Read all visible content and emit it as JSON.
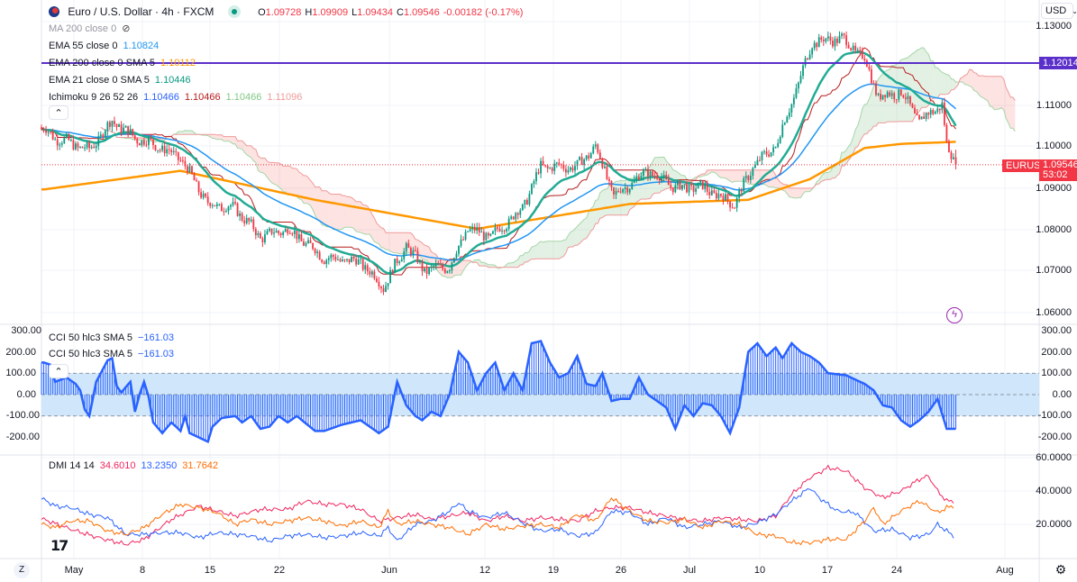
{
  "header": {
    "symbol": "Euro / U.S. Dollar · 4h · FXCM",
    "open_label": "O",
    "open": "1.09728",
    "high_label": "H",
    "high": "1.09909",
    "low_label": "L",
    "low": "1.09434",
    "close_label": "C",
    "close": "1.09546",
    "change": "-0.00182 (-0.17%)",
    "market_status_icon": "market-open-dot"
  },
  "indicators": {
    "ma200": {
      "label": "MA 200 close 0",
      "icon": "eye-hidden-icon"
    },
    "ema55": {
      "label": "EMA 55 close 0",
      "value": "1.10824",
      "color": "#2196f3"
    },
    "ema200": {
      "label": "EMA 200 close 0 SMA 5",
      "value": "1.10112",
      "color": "#ff9800"
    },
    "ema21": {
      "label": "EMA 21 close 0 SMA 5",
      "value": "1.10446",
      "color": "#089981"
    },
    "ichimoku": {
      "label": "Ichimoku 9 26 52 26",
      "v1": "1.10466",
      "v2": "1.10466",
      "v3": "1.10466",
      "v4": "1.11096"
    },
    "cci1": {
      "label": "CCI 50 hlc3 SMA 5",
      "value": "−161.03"
    },
    "cci2": {
      "label": "CCI 50 hlc3 SMA 5",
      "value": "−161.03"
    },
    "dmi": {
      "label": "DMI 14 14",
      "adx": "34.6010",
      "plus": "13.2350",
      "minus": "31.7642"
    }
  },
  "price_axis": {
    "currency": "USD",
    "ticks": [
      "1.13000",
      "1.11000",
      "1.10000",
      "1.09000",
      "1.08000",
      "1.07000",
      "1.06000"
    ],
    "hline_value": "1.12014",
    "symbol_tag": "EURUSD",
    "last_price": "1.09546",
    "countdown": "53:02"
  },
  "cci_axis": {
    "ticks": [
      "300.00",
      "200.00",
      "100.00",
      "0.00",
      "-100.00",
      "-200.00"
    ]
  },
  "dmi_axis": {
    "ticks": [
      "60.0000",
      "40.0000",
      "20.0000"
    ]
  },
  "time_axis": {
    "labels": [
      "May",
      "8",
      "15",
      "22",
      "Jun",
      "12",
      "19",
      "26",
      "Jul",
      "10",
      "17",
      "24",
      "Aug"
    ],
    "zoom_button": "Z"
  },
  "colors": {
    "up": "#089981",
    "down": "#f23645",
    "hline": "#5b2fc9",
    "cci": "#2962ff",
    "adx": "#f0265f",
    "plus_di": "#2962ff",
    "minus_di": "#ff6d00"
  },
  "chart_data": {
    "type": "candlestick",
    "bars": 402,
    "price_path": [
      [
        1,
        1.104
      ],
      [
        6,
        1.102
      ],
      [
        21,
        1.099
      ],
      [
        31,
        1.106
      ],
      [
        41,
        1.102
      ],
      [
        51,
        1.1
      ],
      [
        61,
        1.097
      ],
      [
        73,
        1.086
      ],
      [
        85,
        1.085
      ],
      [
        96,
        1.078
      ],
      [
        108,
        1.08
      ],
      [
        124,
        1.073
      ],
      [
        140,
        1.072
      ],
      [
        150,
        1.066
      ],
      [
        160,
        1.076
      ],
      [
        168,
        1.07
      ],
      [
        179,
        1.071
      ],
      [
        187,
        1.08
      ],
      [
        197,
        1.078
      ],
      [
        211,
        1.085
      ],
      [
        219,
        1.095
      ],
      [
        235,
        1.095
      ],
      [
        243,
        1.1
      ],
      [
        251,
        1.088
      ],
      [
        266,
        1.094
      ],
      [
        278,
        1.09
      ],
      [
        290,
        1.09
      ],
      [
        304,
        1.086
      ],
      [
        312,
        1.095
      ],
      [
        322,
        1.1
      ],
      [
        332,
        1.115
      ],
      [
        338,
        1.125
      ],
      [
        351,
        1.126
      ],
      [
        361,
        1.121
      ],
      [
        367,
        1.112
      ],
      [
        377,
        1.113
      ],
      [
        385,
        1.106
      ],
      [
        395,
        1.11
      ],
      [
        397,
        1.1
      ],
      [
        401,
        1.0955
      ]
    ],
    "ema200_path": [
      [
        1,
        1.0895
      ],
      [
        61,
        1.094
      ],
      [
        120,
        1.087
      ],
      [
        191,
        1.08
      ],
      [
        258,
        1.086
      ],
      [
        310,
        1.087
      ],
      [
        337,
        1.092
      ],
      [
        361,
        1.0995
      ],
      [
        377,
        1.1005
      ],
      [
        401,
        1.101
      ]
    ],
    "cci_path": [
      [
        1,
        150
      ],
      [
        4,
        140
      ],
      [
        6,
        60
      ],
      [
        11,
        80
      ],
      [
        15,
        50
      ],
      [
        17,
        20
      ],
      [
        19,
        -70
      ],
      [
        21,
        -100
      ],
      [
        24,
        60
      ],
      [
        29,
        160
      ],
      [
        31,
        170
      ],
      [
        33,
        40
      ],
      [
        35,
        10
      ],
      [
        39,
        60
      ],
      [
        41,
        -80
      ],
      [
        43,
        0
      ],
      [
        45,
        60
      ],
      [
        47,
        -10
      ],
      [
        49,
        -130
      ],
      [
        53,
        -180
      ],
      [
        57,
        -130
      ],
      [
        61,
        -170
      ],
      [
        63,
        -100
      ],
      [
        65,
        -180
      ],
      [
        69,
        -200
      ],
      [
        73,
        -220
      ],
      [
        75,
        -150
      ],
      [
        79,
        -110
      ],
      [
        85,
        -100
      ],
      [
        88,
        -130
      ],
      [
        92,
        -100
      ],
      [
        96,
        -160
      ],
      [
        100,
        -150
      ],
      [
        104,
        -100
      ],
      [
        108,
        -130
      ],
      [
        112,
        -100
      ],
      [
        120,
        -170
      ],
      [
        124,
        -170
      ],
      [
        132,
        -140
      ],
      [
        140,
        -120
      ],
      [
        148,
        -180
      ],
      [
        152,
        -150
      ],
      [
        156,
        60
      ],
      [
        160,
        -50
      ],
      [
        164,
        -100
      ],
      [
        167,
        -120
      ],
      [
        171,
        -80
      ],
      [
        175,
        -100
      ],
      [
        179,
        0
      ],
      [
        183,
        200
      ],
      [
        187,
        150
      ],
      [
        191,
        20
      ],
      [
        195,
        100
      ],
      [
        199,
        150
      ],
      [
        203,
        20
      ],
      [
        207,
        100
      ],
      [
        211,
        20
      ],
      [
        215,
        240
      ],
      [
        219,
        250
      ],
      [
        223,
        150
      ],
      [
        227,
        80
      ],
      [
        231,
        100
      ],
      [
        235,
        180
      ],
      [
        239,
        50
      ],
      [
        243,
        40
      ],
      [
        246,
        100
      ],
      [
        250,
        -30
      ],
      [
        254,
        -20
      ],
      [
        258,
        -20
      ],
      [
        262,
        80
      ],
      [
        266,
        0
      ],
      [
        270,
        -30
      ],
      [
        274,
        -60
      ],
      [
        278,
        -160
      ],
      [
        282,
        -50
      ],
      [
        286,
        -100
      ],
      [
        290,
        -40
      ],
      [
        294,
        -50
      ],
      [
        298,
        -100
      ],
      [
        302,
        -180
      ],
      [
        306,
        -60
      ],
      [
        310,
        200
      ],
      [
        314,
        240
      ],
      [
        318,
        180
      ],
      [
        322,
        220
      ],
      [
        325,
        170
      ],
      [
        329,
        240
      ],
      [
        333,
        200
      ],
      [
        337,
        180
      ],
      [
        341,
        150
      ],
      [
        345,
        100
      ],
      [
        353,
        90
      ],
      [
        361,
        50
      ],
      [
        365,
        20
      ],
      [
        369,
        -50
      ],
      [
        373,
        -60
      ],
      [
        377,
        -120
      ],
      [
        381,
        -150
      ],
      [
        385,
        -120
      ],
      [
        389,
        -80
      ],
      [
        393,
        -20
      ],
      [
        397,
        -160
      ],
      [
        401,
        -160
      ]
    ],
    "cci_bands": [
      100,
      -100
    ],
    "adx_path": [
      [
        1,
        23
      ],
      [
        13,
        17
      ],
      [
        25,
        12
      ],
      [
        37,
        8
      ],
      [
        45,
        11
      ],
      [
        57,
        23
      ],
      [
        69,
        31
      ],
      [
        85,
        25
      ],
      [
        96,
        29
      ],
      [
        108,
        29
      ],
      [
        116,
        34
      ],
      [
        124,
        32
      ],
      [
        132,
        32
      ],
      [
        140,
        29
      ],
      [
        148,
        22
      ],
      [
        156,
        24
      ],
      [
        164,
        26
      ],
      [
        171,
        23
      ],
      [
        179,
        25
      ],
      [
        187,
        27
      ],
      [
        195,
        22
      ],
      [
        203,
        25
      ],
      [
        211,
        22
      ],
      [
        219,
        24
      ],
      [
        227,
        23
      ],
      [
        235,
        22
      ],
      [
        243,
        28
      ],
      [
        250,
        30
      ],
      [
        258,
        30
      ],
      [
        266,
        27
      ],
      [
        274,
        25
      ],
      [
        282,
        23
      ],
      [
        290,
        22
      ],
      [
        298,
        24
      ],
      [
        306,
        23
      ],
      [
        314,
        22
      ],
      [
        322,
        25
      ],
      [
        329,
        38
      ],
      [
        337,
        48
      ],
      [
        345,
        54
      ],
      [
        353,
        52
      ],
      [
        361,
        42
      ],
      [
        369,
        36
      ],
      [
        377,
        40
      ],
      [
        385,
        47
      ],
      [
        389,
        49
      ],
      [
        393,
        40
      ],
      [
        397,
        34
      ],
      [
        400,
        34
      ]
    ],
    "plus_di_path": [
      [
        1,
        35
      ],
      [
        6,
        31
      ],
      [
        13,
        30
      ],
      [
        21,
        26
      ],
      [
        29,
        24
      ],
      [
        37,
        14
      ],
      [
        45,
        14
      ],
      [
        53,
        15
      ],
      [
        61,
        15
      ],
      [
        69,
        12
      ],
      [
        77,
        15
      ],
      [
        85,
        14
      ],
      [
        92,
        13
      ],
      [
        100,
        10
      ],
      [
        108,
        13
      ],
      [
        116,
        14
      ],
      [
        124,
        12
      ],
      [
        132,
        13
      ],
      [
        140,
        15
      ],
      [
        148,
        13
      ],
      [
        152,
        18
      ],
      [
        156,
        10
      ],
      [
        164,
        20
      ],
      [
        171,
        22
      ],
      [
        179,
        28
      ],
      [
        183,
        33
      ],
      [
        187,
        28
      ],
      [
        195,
        24
      ],
      [
        203,
        27
      ],
      [
        211,
        21
      ],
      [
        219,
        16
      ],
      [
        227,
        17
      ],
      [
        235,
        13
      ],
      [
        243,
        15
      ],
      [
        250,
        28
      ],
      [
        258,
        27
      ],
      [
        266,
        20
      ],
      [
        274,
        24
      ],
      [
        282,
        18
      ],
      [
        290,
        20
      ],
      [
        298,
        22
      ],
      [
        306,
        18
      ],
      [
        314,
        21
      ],
      [
        322,
        26
      ],
      [
        329,
        34
      ],
      [
        337,
        42
      ],
      [
        341,
        36
      ],
      [
        349,
        28
      ],
      [
        357,
        27
      ],
      [
        365,
        16
      ],
      [
        373,
        17
      ],
      [
        381,
        12
      ],
      [
        389,
        14
      ],
      [
        393,
        20
      ],
      [
        397,
        16
      ],
      [
        400,
        13
      ]
    ],
    "minus_di_path": [
      [
        1,
        20
      ],
      [
        6,
        18
      ],
      [
        13,
        22
      ],
      [
        21,
        22
      ],
      [
        29,
        16
      ],
      [
        37,
        14
      ],
      [
        45,
        18
      ],
      [
        53,
        26
      ],
      [
        61,
        32
      ],
      [
        69,
        30
      ],
      [
        77,
        27
      ],
      [
        85,
        20
      ],
      [
        92,
        23
      ],
      [
        100,
        20
      ],
      [
        108,
        22
      ],
      [
        116,
        24
      ],
      [
        124,
        22
      ],
      [
        132,
        19
      ],
      [
        140,
        22
      ],
      [
        148,
        18
      ],
      [
        152,
        28
      ],
      [
        156,
        20
      ],
      [
        164,
        22
      ],
      [
        171,
        20
      ],
      [
        179,
        18
      ],
      [
        187,
        14
      ],
      [
        195,
        20
      ],
      [
        203,
        17
      ],
      [
        211,
        19
      ],
      [
        219,
        20
      ],
      [
        227,
        18
      ],
      [
        235,
        26
      ],
      [
        243,
        22
      ],
      [
        250,
        36
      ],
      [
        258,
        28
      ],
      [
        266,
        22
      ],
      [
        274,
        21
      ],
      [
        282,
        23
      ],
      [
        290,
        18
      ],
      [
        298,
        22
      ],
      [
        306,
        20
      ],
      [
        314,
        14
      ],
      [
        322,
        13
      ],
      [
        329,
        9
      ],
      [
        337,
        9
      ],
      [
        345,
        11
      ],
      [
        353,
        11
      ],
      [
        361,
        22
      ],
      [
        365,
        30
      ],
      [
        369,
        20
      ],
      [
        377,
        28
      ],
      [
        385,
        34
      ],
      [
        393,
        27
      ],
      [
        397,
        30
      ],
      [
        400,
        31
      ]
    ]
  }
}
